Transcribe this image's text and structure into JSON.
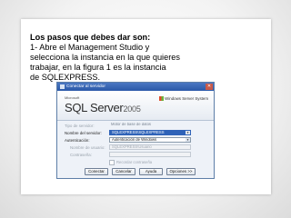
{
  "slide": {
    "heading": "Los pasos que debes dar son:",
    "lines": [
      "1- Abre el Management Studio y",
      "selecciona la instancia en la que quieres",
      "trabajar, en la figura 1 es la instancia",
      "de SQLEXPRESS."
    ]
  },
  "dialog": {
    "title": "Conectar al servidor",
    "logo_ms": "Microsoft",
    "logo_product": "SQL Server",
    "logo_version": "2005",
    "ws_logo": "Windows Server System",
    "fields": {
      "server_type_label": "Tipo de servidor:",
      "server_type_value": "Motor de base de datos",
      "server_name_label": "Nombre del servidor:",
      "server_name_value": "SQLEXPRESS\\SQLEXPRESS",
      "auth_label": "Autenticación:",
      "auth_value": "Autenticación de Windows",
      "user_label": "Nombre de usuario:",
      "user_value": "SQLEXPRESS\\Usuario",
      "password_label": "Contraseña:",
      "password_value": "",
      "remember_label": "Recordar contraseña"
    },
    "buttons": {
      "connect": "Conectar",
      "cancel": "Cancelar",
      "help": "Ayuda",
      "options": "Opciones >>"
    }
  }
}
